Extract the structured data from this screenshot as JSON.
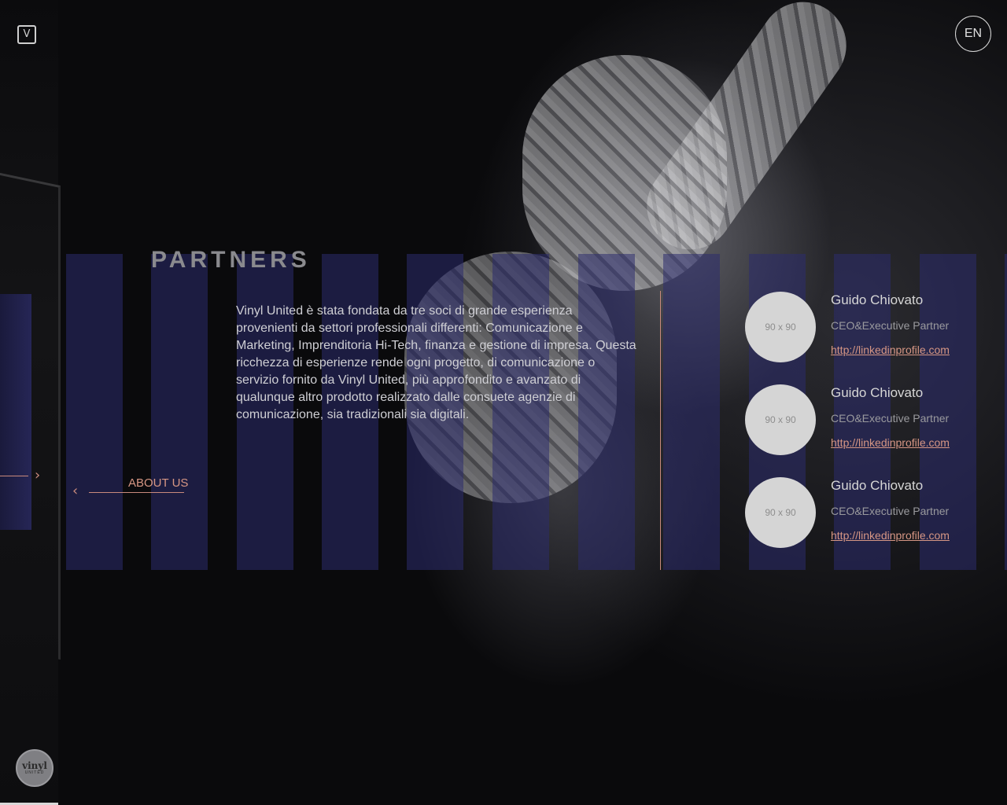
{
  "header": {
    "logo_text": "V",
    "lang_button_label": "EN"
  },
  "footer": {
    "badge_title": "vinyl",
    "badge_subtitle": "UNITED"
  },
  "section": {
    "title": "PARTNERS",
    "intro": "Vinyl United è stata fondata da tre soci di grande esperienza provenienti da settori professionali differenti: Comunicazione e Marketing, Imprenditoria Hi-Tech, finanza e gestione di impresa. Questa ricchezza di esperienze rende ogni progetto, di comunicazione o servizio fornito da Vinyl United, più approfondito e avanzato di qualunque altro prodotto realizzato dalle consuete agenzie di comunicazione, sia tradizionali sia digitali.",
    "back_link_label": "ABOUT US"
  },
  "partners": [
    {
      "avatar_text": "90 x 90",
      "name": "Guido Chiovato",
      "role": "CEO&Executive Partner",
      "link": "http://linkedinprofile.com"
    },
    {
      "avatar_text": "90 x 90",
      "name": "Guido Chiovato",
      "role": "CEO&Executive Partner",
      "link": "http://linkedinprofile.com"
    },
    {
      "avatar_text": "90 x 90",
      "name": "Guido Chiovato",
      "role": "CEO&Executive Partner",
      "link": "http://linkedinprofile.com"
    }
  ],
  "icons": {
    "prev": "chevron-left-icon",
    "next": "chevron-right-icon",
    "logo": "vinyl-logo-icon"
  },
  "colors": {
    "accent": "#d69684",
    "stripe": "#2c2c6e",
    "background": "#050507"
  }
}
